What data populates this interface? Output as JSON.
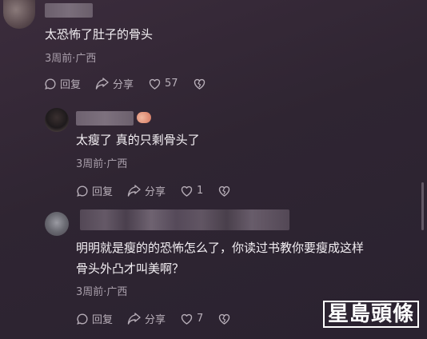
{
  "comments": [
    {
      "text": "太恐怖了肚子的骨头",
      "meta": "3周前·广西",
      "reply": "回复",
      "share": "分享",
      "likes": "57"
    },
    {
      "text": "太瘦了 真的只剩骨头了",
      "meta": "3周前·广西",
      "reply": "回复",
      "share": "分享",
      "likes": "1"
    },
    {
      "text_line1": "明明就是瘦的的恐怖怎么了，你读过书教你要瘦成这样",
      "text_line2": "骨头外凸才叫美啊？",
      "meta": "3周前·广西",
      "reply": "回复",
      "share": "分享",
      "likes": "7"
    }
  ],
  "watermark": "星島頭條",
  "icons": {
    "reply": "reply-bubble-icon",
    "share": "share-arrow-icon",
    "like": "heart-icon",
    "dislike": "broken-heart-icon"
  }
}
